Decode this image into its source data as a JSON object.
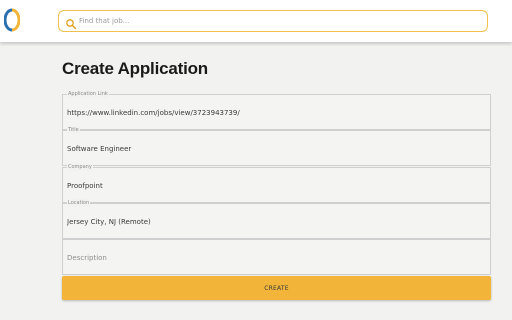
{
  "header": {
    "search_placeholder": "Find that job..."
  },
  "page": {
    "title": "Create Application"
  },
  "form": {
    "fields": [
      {
        "label": "Application Link",
        "value": "https://www.linkedin.com/jobs/view/3723943739/",
        "placeholder": ""
      },
      {
        "label": "Title",
        "value": "Software Engineer",
        "placeholder": ""
      },
      {
        "label": "Company",
        "value": "Proofpoint",
        "placeholder": ""
      },
      {
        "label": "Location",
        "value": "Jersey City, NJ (Remote)",
        "placeholder": ""
      },
      {
        "label": "",
        "value": "",
        "placeholder": "Description"
      }
    ],
    "submit_label": "CREATE"
  },
  "colors": {
    "accent": "#f2b53a",
    "search_border": "#f0c050",
    "logo_blue": "#2a6fb0",
    "logo_yellow": "#f2b53a"
  },
  "icons": {
    "logo": "app-logo-icon",
    "search": "search-icon"
  }
}
